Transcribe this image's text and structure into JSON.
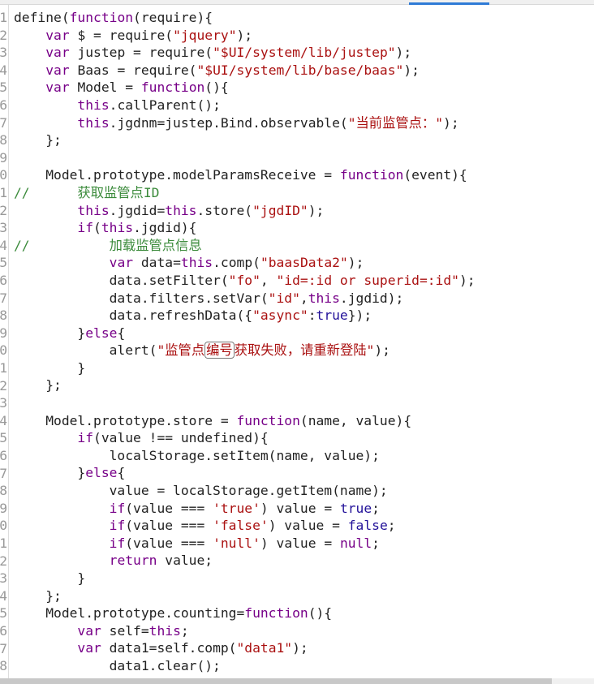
{
  "editor": {
    "colors": {
      "keyword": "#770088",
      "string": "#aa1111",
      "atom": "#221199",
      "comment": "#3a8a3a",
      "active_tab": "#2f7bd6"
    },
    "lines": [
      [
        [
          "p",
          "define("
        ],
        [
          "k",
          "function"
        ],
        [
          "p",
          "(require){"
        ]
      ],
      [
        [
          "p",
          "    "
        ],
        [
          "k",
          "var"
        ],
        [
          "p",
          " $ = require("
        ],
        [
          "s",
          "\"jquery\""
        ],
        [
          "p",
          ");"
        ]
      ],
      [
        [
          "p",
          "    "
        ],
        [
          "k",
          "var"
        ],
        [
          "p",
          " justep = require("
        ],
        [
          "s",
          "\"$UI/system/lib/justep\""
        ],
        [
          "p",
          ");"
        ]
      ],
      [
        [
          "p",
          "    "
        ],
        [
          "k",
          "var"
        ],
        [
          "p",
          " Baas = require("
        ],
        [
          "s",
          "\"$UI/system/lib/base/baas\""
        ],
        [
          "p",
          ");"
        ]
      ],
      [
        [
          "p",
          "    "
        ],
        [
          "k",
          "var"
        ],
        [
          "p",
          " Model = "
        ],
        [
          "k",
          "function"
        ],
        [
          "p",
          "(){"
        ]
      ],
      [
        [
          "p",
          "        "
        ],
        [
          "k",
          "this"
        ],
        [
          "p",
          ".callParent();"
        ]
      ],
      [
        [
          "p",
          "        "
        ],
        [
          "k",
          "this"
        ],
        [
          "p",
          ".jgdnm=justep.Bind.observable("
        ],
        [
          "s",
          "\"当前监管点：\""
        ],
        [
          "p",
          ");"
        ]
      ],
      [
        [
          "p",
          "    };"
        ]
      ],
      [],
      [
        [
          "p",
          "    Model.prototype.modelParamsReceive = "
        ],
        [
          "k",
          "function"
        ],
        [
          "p",
          "(event){"
        ]
      ],
      [
        [
          "c",
          "//      获取监管点ID"
        ]
      ],
      [
        [
          "p",
          "        "
        ],
        [
          "k",
          "this"
        ],
        [
          "p",
          ".jgdid="
        ],
        [
          "k",
          "this"
        ],
        [
          "p",
          ".store("
        ],
        [
          "s",
          "\"jgdID\""
        ],
        [
          "p",
          ");"
        ]
      ],
      [
        [
          "p",
          "        "
        ],
        [
          "k",
          "if"
        ],
        [
          "p",
          "("
        ],
        [
          "k",
          "this"
        ],
        [
          "p",
          ".jgdid){"
        ]
      ],
      [
        [
          "c",
          "//          加载监管点信息"
        ]
      ],
      [
        [
          "p",
          "            "
        ],
        [
          "k",
          "var"
        ],
        [
          "p",
          " data="
        ],
        [
          "k",
          "this"
        ],
        [
          "p",
          ".comp("
        ],
        [
          "s",
          "\"baasData2\""
        ],
        [
          "p",
          ");"
        ]
      ],
      [
        [
          "p",
          "            data.setFilter("
        ],
        [
          "s",
          "\"fo\""
        ],
        [
          "p",
          ", "
        ],
        [
          "s",
          "\"id=:id or superid=:id\""
        ],
        [
          "p",
          ");"
        ]
      ],
      [
        [
          "p",
          "            data.filters.setVar("
        ],
        [
          "s",
          "\"id\""
        ],
        [
          "p",
          ","
        ],
        [
          "k",
          "this"
        ],
        [
          "p",
          ".jgdid);"
        ]
      ],
      [
        [
          "p",
          "            data.refreshData({"
        ],
        [
          "s",
          "\"async\""
        ],
        [
          "p",
          ":"
        ],
        [
          "a",
          "true"
        ],
        [
          "p",
          "});"
        ]
      ],
      [
        [
          "p",
          "        }"
        ],
        [
          "k",
          "else"
        ],
        [
          "p",
          "{"
        ]
      ],
      [
        [
          "p",
          "            alert("
        ],
        [
          "s",
          "\"监管点"
        ],
        [
          "box",
          "编号"
        ],
        [
          "s",
          "获取失败，请重新登陆\""
        ],
        [
          "p",
          ");"
        ]
      ],
      [
        [
          "p",
          "        }"
        ]
      ],
      [
        [
          "p",
          "    };"
        ]
      ],
      [],
      [
        [
          "p",
          "    Model.prototype.store = "
        ],
        [
          "k",
          "function"
        ],
        [
          "p",
          "(name, value){"
        ]
      ],
      [
        [
          "p",
          "        "
        ],
        [
          "k",
          "if"
        ],
        [
          "p",
          "(value !== undefined){"
        ]
      ],
      [
        [
          "p",
          "            localStorage.setItem(name, value);"
        ]
      ],
      [
        [
          "p",
          "        }"
        ],
        [
          "k",
          "else"
        ],
        [
          "p",
          "{"
        ]
      ],
      [
        [
          "p",
          "            value = localStorage.getItem(name);"
        ]
      ],
      [
        [
          "p",
          "            "
        ],
        [
          "k",
          "if"
        ],
        [
          "p",
          "(value === "
        ],
        [
          "s",
          "'true'"
        ],
        [
          "p",
          ") value = "
        ],
        [
          "a",
          "true"
        ],
        [
          "p",
          ";"
        ]
      ],
      [
        [
          "p",
          "            "
        ],
        [
          "k",
          "if"
        ],
        [
          "p",
          "(value === "
        ],
        [
          "s",
          "'false'"
        ],
        [
          "p",
          ") value = "
        ],
        [
          "a",
          "false"
        ],
        [
          "p",
          ";"
        ]
      ],
      [
        [
          "p",
          "            "
        ],
        [
          "k",
          "if"
        ],
        [
          "p",
          "(value === "
        ],
        [
          "s",
          "'null'"
        ],
        [
          "p",
          ") value = "
        ],
        [
          "k",
          "null"
        ],
        [
          "p",
          ";"
        ]
      ],
      [
        [
          "p",
          "            "
        ],
        [
          "k",
          "return"
        ],
        [
          "p",
          " value;"
        ]
      ],
      [
        [
          "p",
          "        }"
        ]
      ],
      [
        [
          "p",
          "    };"
        ]
      ],
      [
        [
          "p",
          "    Model.prototype.counting="
        ],
        [
          "k",
          "function"
        ],
        [
          "p",
          "(){"
        ]
      ],
      [
        [
          "p",
          "        "
        ],
        [
          "k",
          "var"
        ],
        [
          "p",
          " self="
        ],
        [
          "k",
          "this"
        ],
        [
          "p",
          ";"
        ]
      ],
      [
        [
          "p",
          "        "
        ],
        [
          "k",
          "var"
        ],
        [
          "p",
          " data1=self.comp("
        ],
        [
          "s",
          "\"data1\""
        ],
        [
          "p",
          ");"
        ]
      ],
      [
        [
          "p",
          "            data1.clear();"
        ]
      ]
    ]
  }
}
